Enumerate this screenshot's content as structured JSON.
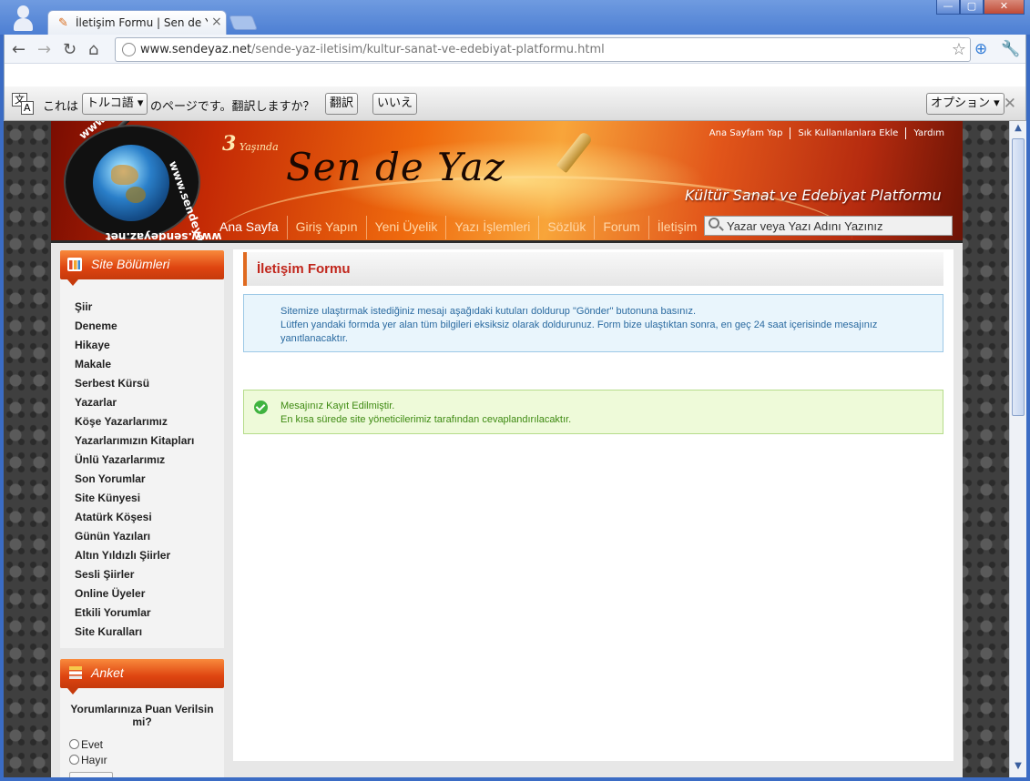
{
  "browser": {
    "tab_title": "İletişim Formu | Sen de Yaz",
    "tab_favicon": "pencil-icon",
    "tab_close": "×",
    "url_domain": "www.sendeyaz.net",
    "url_path": "/sende-yaz-iletisim/kultur-sanat-ve-edebiyat-platformu.html",
    "bookmark_star": "☆",
    "window_controls": [
      "—",
      "▢",
      "✕"
    ]
  },
  "translate_bar": {
    "prefix": "これは",
    "language": "トルコ語 ▾",
    "message": "のページです。翻訳しますか？",
    "translate_button": "翻訳",
    "no_button": "いいえ",
    "options_button": "オプション ▾",
    "close": "✕"
  },
  "header": {
    "logo_text_top": "www.sendeyaz.net",
    "logo_text_bottom": "www.sendeyaz.net",
    "logo_text_side": "www.sendeyaz.net",
    "anniversary_number": "3",
    "anniversary_word": "Yaşında",
    "brand": "Sen de Yaz",
    "slogan": "Kültür Sanat ve Edebiyat Platformu",
    "top_links": [
      "Ana Sayfam Yap",
      "Sık Kullanılanlara Ekle",
      "Yardım"
    ],
    "menu": [
      "Ana Sayfa",
      "Giriş Yapın",
      "Yeni Üyelik",
      "Yazı İşlemleri",
      "Sözlük",
      "Forum",
      "İletişim"
    ],
    "search_placeholder": "Yazar veya Yazı Adını Yazınız"
  },
  "sidebar": {
    "sections_title": "Site Bölümleri",
    "items": [
      "Şiir",
      "Deneme",
      "Hikaye",
      "Makale",
      "Serbest Kürsü",
      "Yazarlar",
      "Köşe Yazarlarımız",
      "Yazarlarımızın Kitapları",
      "Ünlü Yazarlarımız",
      "Son Yorumlar",
      "Site Künyesi",
      "Atatürk Köşesi",
      "Günün Yazıları",
      "Altın Yıldızlı Şiirler",
      "Sesli Şiirler",
      "Online Üyeler",
      "Etkili Yorumlar",
      "Site Kuralları"
    ],
    "poll_title": "Anket",
    "poll_question": "Yorumlarınıza Puan Verilsin mi?",
    "poll_options": [
      "Evet",
      "Hayır"
    ]
  },
  "main": {
    "title": "İletişim Formu",
    "info_line1": "Sitemize ulaştırmak istediğiniz mesajı aşağıdaki kutuları doldurup \"Gönder\" butonuna basınız.",
    "info_line2": "Lütfen yandaki formda yer alan tüm bilgileri eksiksiz olarak doldurunuz. Form bize ulaştıktan sonra, en geç 24 saat içerisinde mesajınız yanıtlanacaktır.",
    "success_line1": "Mesajınız Kayıt Edilmiştir.",
    "success_line2": "En kısa sürede site yöneticilerimiz tarafından cevaplandırılacaktır."
  }
}
